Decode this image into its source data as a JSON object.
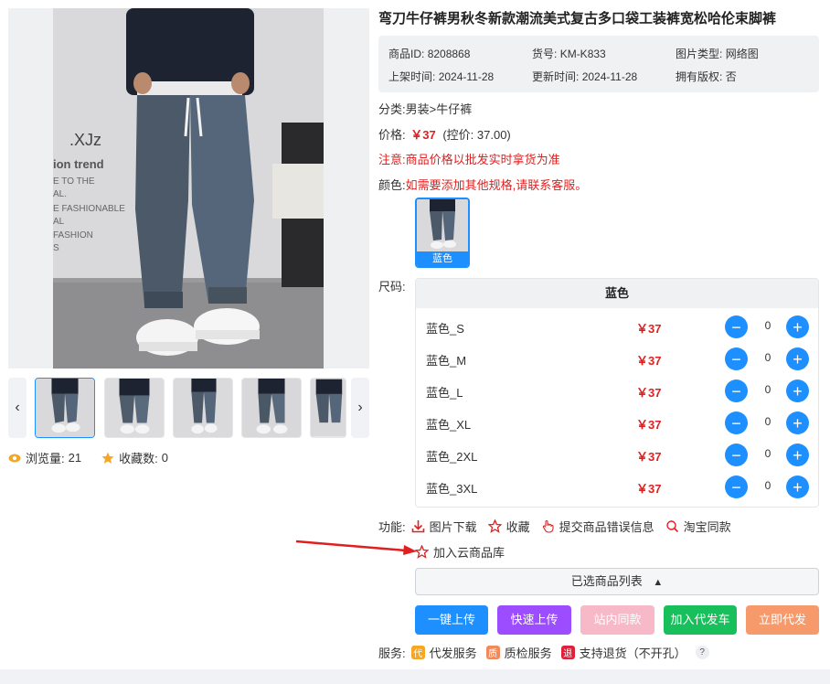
{
  "product": {
    "title": "弯刀牛仔裤男秋冬新款潮流美式复古多口袋工装裤宽松哈伦束脚裤"
  },
  "info": {
    "id_label": "商品ID:",
    "id_value": "8208868",
    "sku_label": "货号:",
    "sku_value": "KM-K833",
    "img_type_label": "图片类型:",
    "img_type_value": "网络图",
    "listed_label": "上架时间:",
    "listed_value": "2024-11-28",
    "updated_label": "更新时间:",
    "updated_value": "2024-11-28",
    "copyright_label": "拥有版权:",
    "copyright_value": "否"
  },
  "category": {
    "label": "分类:",
    "value": "男装>牛仔裤"
  },
  "price": {
    "label": "价格:",
    "value": "￥37",
    "control": "(控价: 37.00)"
  },
  "notice": {
    "label": "注意:",
    "text": "商品价格以批发实时拿货为准"
  },
  "color": {
    "label": "颜色:",
    "text": "如需要添加其他规格,请联系客服。",
    "swatch_label": "蓝色"
  },
  "sizes": {
    "label": "尺码:",
    "header": "蓝色",
    "rows": [
      {
        "name": "蓝色_S",
        "price": "￥37",
        "qty": "0"
      },
      {
        "name": "蓝色_M",
        "price": "￥37",
        "qty": "0"
      },
      {
        "name": "蓝色_L",
        "price": "￥37",
        "qty": "0"
      },
      {
        "name": "蓝色_XL",
        "price": "￥37",
        "qty": "0"
      },
      {
        "name": "蓝色_2XL",
        "price": "￥37",
        "qty": "0"
      },
      {
        "name": "蓝色_3XL",
        "price": "￥37",
        "qty": "0"
      }
    ],
    "minus_label": "−",
    "plus_label": "+"
  },
  "functions": {
    "label": "功能:",
    "download": "图片下载",
    "favorite": "收藏",
    "report": "提交商品错误信息",
    "taobao": "淘宝同款",
    "cloud": "加入云商品库"
  },
  "selected_list": {
    "label": "已选商品列表",
    "arrow": "▲"
  },
  "actions": {
    "one_click": "一键上传",
    "quick": "快速上传",
    "same_site": "站内同款",
    "add_dropship": "加入代发车",
    "dropship_now": "立即代发"
  },
  "services": {
    "label": "服务:",
    "items": [
      {
        "badge": "代",
        "text": "代发服务",
        "color": "#f5a623"
      },
      {
        "badge": "质",
        "text": "质检服务",
        "color": "#f08a5d"
      },
      {
        "badge": "退",
        "text": "支持退货（不开孔）",
        "color": "#e0203b"
      }
    ],
    "help": "?"
  },
  "stats": {
    "views_label": "浏览量:",
    "views_value": "21",
    "favs_label": "收藏数:",
    "favs_value": "0"
  },
  "gallery": {
    "prev": "‹",
    "next": "›",
    "overlay_brand": ".XJz",
    "overlay_lines": [
      "ion trend",
      "E TO THE",
      "AL.",
      "E FASHIONABLE",
      "AL",
      "FASHION",
      "S"
    ]
  },
  "colors": {
    "accent": "#1e8fff",
    "price": "#e02020",
    "btn_one_click": "#1e8fff",
    "btn_quick": "#9b4dff",
    "btn_same_site": "#f7b8c8",
    "btn_add_dropship": "#17c05a",
    "btn_dropship_now": "#f79a6b"
  }
}
